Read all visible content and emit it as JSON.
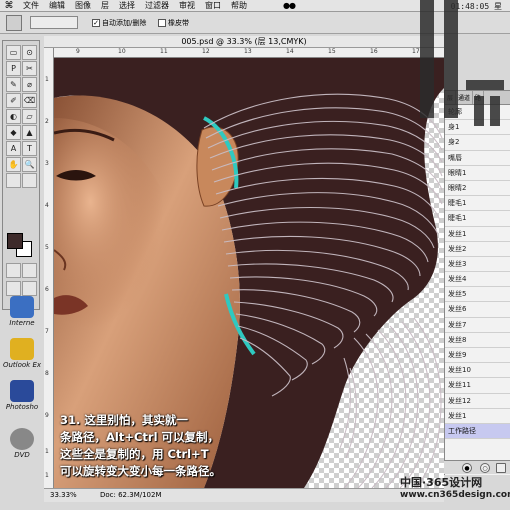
{
  "menu": {
    "items": [
      "文件",
      "编辑",
      "图像",
      "层",
      "选择",
      "过滤器",
      "审视",
      "窗口",
      "帮助"
    ],
    "clock": "01:48:05 星"
  },
  "options": {
    "auto_add_label": "自动添加/删除",
    "rubber_band_label": "橡皮带",
    "auto_add_checked": true
  },
  "document": {
    "title": "005.psd @ 33.3% (层 13,CMYK)"
  },
  "rulers": {
    "top": [
      "9",
      "10",
      "11",
      "12",
      "13",
      "14",
      "15",
      "16",
      "17"
    ],
    "left": [
      "1",
      "2",
      "3",
      "4",
      "5",
      "6",
      "7",
      "8",
      "9",
      "1",
      "1"
    ]
  },
  "tools": [
    "▭",
    "⊙",
    "P",
    "✂",
    "✎",
    "⌀",
    "✐",
    "⌫",
    "◐",
    "▱",
    "◆",
    "▲",
    "A",
    "T",
    "✋",
    "🔍"
  ],
  "desktop": {
    "items": [
      {
        "label": "Interne",
        "color": "#3b6fc2"
      },
      {
        "label": "Outlook Ex",
        "color": "#e0b020"
      },
      {
        "label": "Photosho",
        "color": "#2a4a9a"
      },
      {
        "label": "DVD",
        "color": "#888888"
      }
    ]
  },
  "status": {
    "zoom": "33.33%",
    "doc": "Doc: 62.3M/102M"
  },
  "layers_panel": {
    "tabs": [
      "层",
      "通道",
      "路"
    ],
    "items": [
      {
        "name": "轮廓",
        "selected": false
      },
      {
        "name": "身1",
        "selected": false
      },
      {
        "name": "身2",
        "selected": false
      },
      {
        "name": "嘴唇",
        "selected": false
      },
      {
        "name": "眼睛1",
        "selected": false
      },
      {
        "name": "眼睛2",
        "selected": false
      },
      {
        "name": "睫毛1",
        "selected": false
      },
      {
        "name": "睫毛1",
        "selected": false
      },
      {
        "name": "发丝1",
        "selected": false
      },
      {
        "name": "发丝2",
        "selected": false
      },
      {
        "name": "发丝3",
        "selected": false
      },
      {
        "name": "发丝4",
        "selected": false
      },
      {
        "name": "发丝5",
        "selected": false
      },
      {
        "name": "发丝6",
        "selected": false
      },
      {
        "name": "发丝7",
        "selected": false
      },
      {
        "name": "发丝8",
        "selected": false
      },
      {
        "name": "发丝9",
        "selected": false
      },
      {
        "name": "发丝10",
        "selected": false
      },
      {
        "name": "发丝11",
        "selected": false
      },
      {
        "name": "发丝12",
        "selected": false
      },
      {
        "name": "发丝1",
        "selected": false
      },
      {
        "name": "工作路径",
        "selected": true
      }
    ]
  },
  "caption": {
    "lines": [
      "31. 这里别怕，其实就一",
      "条路径，Alt+Ctrl 可以复制，",
      "这些全是复制的，用 Ctrl+T",
      "可以旋转变大变小每一条路径。"
    ]
  },
  "watermark": {
    "cn": "中国·365设计网",
    "url": "www.cn365design.com"
  },
  "colors": {
    "hair": "#3a2020",
    "skin": "#c98a5e",
    "strands": "#c8bcc4",
    "accent": "#2fc9c0",
    "selection": "#c7c9f0"
  }
}
